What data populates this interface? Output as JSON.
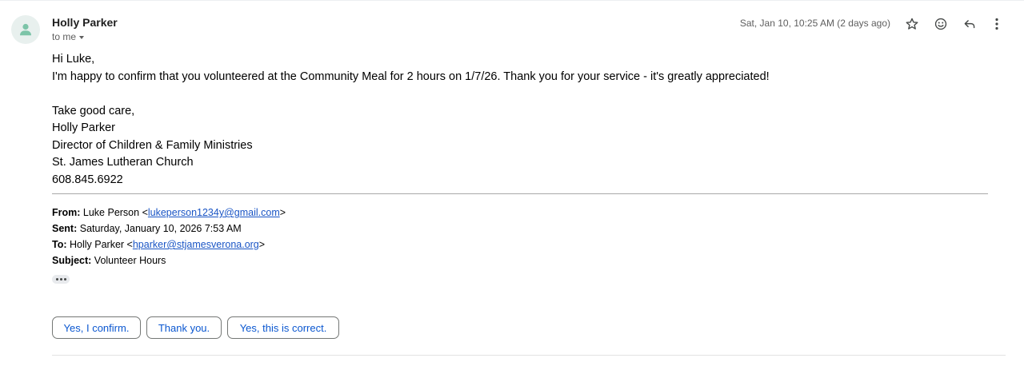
{
  "message": {
    "sender_name": "Holly Parker",
    "to_label": "to me",
    "date": "Sat, Jan 10, 10:25 AM (2 days ago)"
  },
  "icons": {
    "avatar": "person-icon",
    "star": "star-icon",
    "emoji": "smiley-icon",
    "reply": "reply-icon",
    "more": "more-vert-icon"
  },
  "body": {
    "greeting": "Hi Luke,",
    "message": "I'm happy to confirm that you volunteered at the Community Meal for 2 hours on 1/7/26. Thank you for your service - it's greatly appreciated!",
    "closing": "Take good care,",
    "signature": [
      "Holly Parker",
      "Director of Children & Family Ministries",
      "St. James Lutheran Church",
      "608.845.6922"
    ]
  },
  "quoted": {
    "from_label": "From:",
    "from_name": "Luke Person <",
    "from_email": "lukeperson1234y@gmail.com",
    "from_close": ">",
    "sent_label": "Sent:",
    "sent_value": "Saturday, January 10, 2026 7:53 AM",
    "to_label": "To:",
    "to_name": "Holly Parker <",
    "to_email": "hparker@stjamesverona.org",
    "to_close": ">",
    "subject_label": "Subject:",
    "subject_value": "Volunteer Hours"
  },
  "smart_replies": [
    "Yes, I confirm.",
    "Thank you.",
    "Yes, this is correct."
  ],
  "colors": {
    "link": "#1a55c5",
    "smart_reply_text": "#0b57d0",
    "avatar_bg": "#e8f0ee",
    "avatar_fg": "#7cc4a8"
  }
}
